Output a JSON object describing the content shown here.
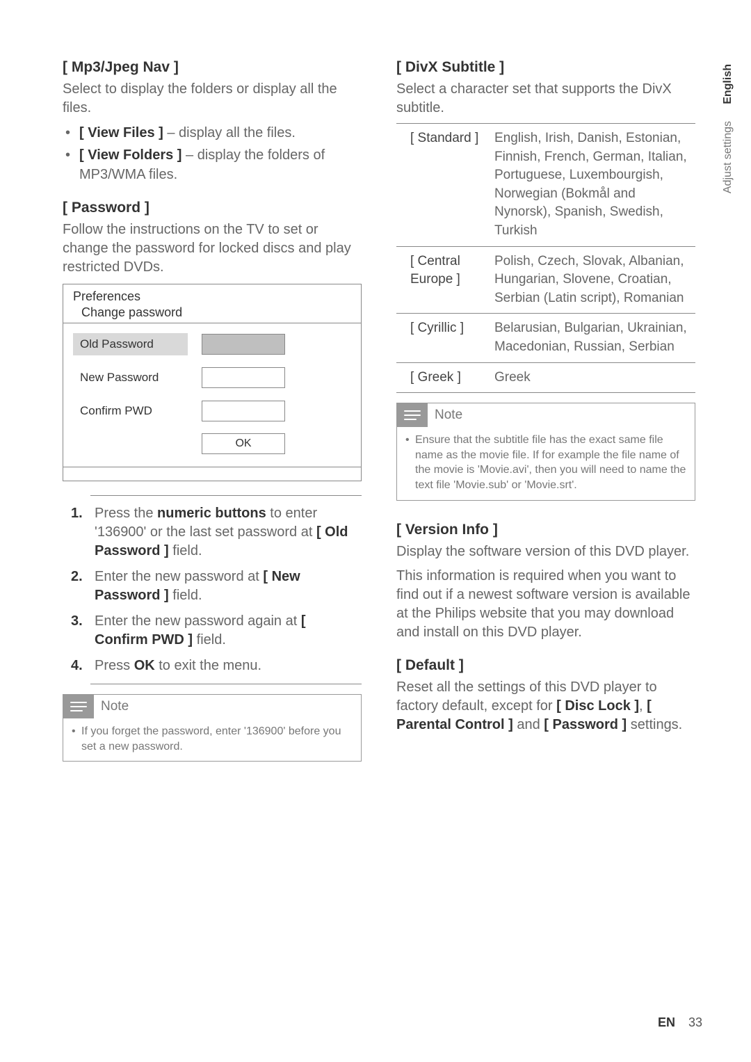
{
  "left": {
    "mp3_title": "[ Mp3/Jpeg Nav ]",
    "mp3_body": "Select to display the folders or display all the files.",
    "view_files_label": "[ View Files ]",
    "view_files_rest": " – display all the files.",
    "view_folders_label": "[ View Folders ]",
    "view_folders_rest": " – display the folders of MP3/WMA files.",
    "password_title": "[ Password ]",
    "password_body": "Follow the instructions on the TV to set or change the password for locked discs and play restricted DVDs.",
    "panel_header_1": "Preferences",
    "panel_header_2": "Change password",
    "old_pw": "Old Password",
    "new_pw": "New Password",
    "confirm_pw": "Confirm PWD",
    "ok": "OK",
    "step1_a": "Press the ",
    "step1_b": "numeric buttons",
    "step1_c": " to enter '136900' or the last set password at ",
    "step1_d": "[ Old Password ]",
    "step1_e": " field.",
    "step2_a": "Enter the new password at ",
    "step2_b": "[ New Password ]",
    "step2_c": " field.",
    "step3_a": "Enter the new password again at ",
    "step3_b": "[ Confirm PWD ]",
    "step3_c": " field.",
    "step4_a": "Press ",
    "step4_b": "OK",
    "step4_c": " to exit the menu.",
    "note_title": "Note",
    "note_body": "If you forget the password, enter '136900' before you set a new password."
  },
  "right": {
    "divx_title": "[ DivX Subtitle ]",
    "divx_body": "Select a character set that supports the DivX subtitle.",
    "rows": [
      {
        "label": "[ Standard ]",
        "value": "English, Irish, Danish, Estonian, Finnish, French, German, Italian, Portuguese, Luxembourgish, Norwegian (Bokmål and Nynorsk), Spanish, Swedish, Turkish"
      },
      {
        "label": "[ Central Europe ]",
        "value": "Polish, Czech, Slovak, Albanian, Hungarian, Slovene, Croatian, Serbian (Latin script), Romanian"
      },
      {
        "label": "[ Cyrillic ]",
        "value": "Belarusian, Bulgarian, Ukrainian, Macedonian, Russian, Serbian"
      },
      {
        "label": "[ Greek ]",
        "value": "Greek"
      }
    ],
    "note_title": "Note",
    "note_body": "Ensure that the subtitle file has the exact same file name as the movie file. If for example the file name of the movie is 'Movie.avi', then you will need to name the text file 'Movie.sub' or 'Movie.srt'.",
    "version_title": "[ Version Info ]",
    "version_body1": "Display the software version of this DVD player.",
    "version_body2": "This information is required when you want to find out if a newest software version is available at the Philips website that you may download and install on this DVD player.",
    "default_title": "[ Default ]",
    "default_a": "Reset all the settings of this DVD player to factory default, except for ",
    "default_b": "[ Disc Lock ]",
    "default_c": ", ",
    "default_d": "[ Parental Control ]",
    "default_e": " and ",
    "default_f": "[ Password ]",
    "default_g": " settings."
  },
  "tabs": {
    "english": "English",
    "adjust": "Adjust settings"
  },
  "footer": {
    "lang": "EN",
    "page": "33"
  }
}
